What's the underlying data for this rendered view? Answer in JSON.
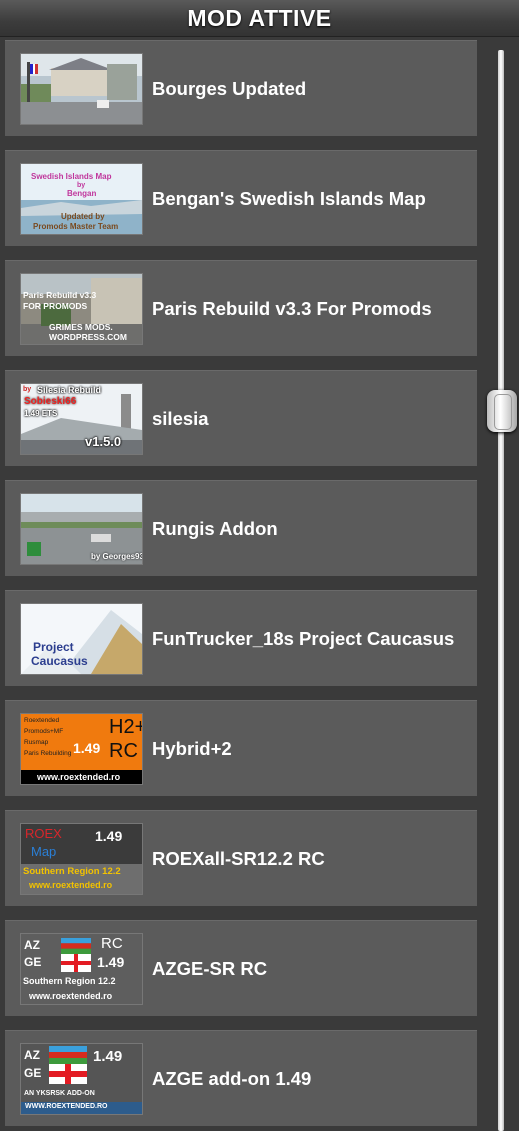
{
  "header": {
    "title": "MOD ATTIVE"
  },
  "mods": [
    {
      "name": "Bourges Updated",
      "thumb": {}
    },
    {
      "name": "Bengan's Swedish Islands Map",
      "thumb": {
        "line1": "Swedish Islands Map",
        "line2": "by",
        "line3": "Bengan",
        "line4": "Updated by",
        "line5": "Promods Master Team"
      }
    },
    {
      "name": "Paris Rebuild v3.3 For Promods",
      "thumb": {
        "line1": "Paris Rebuild v3.3",
        "line2": "FOR PROMODS",
        "line3": "GRIMES MODS.",
        "line4": "WORDPRESS.COM"
      }
    },
    {
      "name": "silesia",
      "thumb": {
        "line1": "by",
        "line2": "Silesia Rebuild",
        "line3": "Sobieski66",
        "line4": "1.49 ETS",
        "line5": "v1.5.0"
      }
    },
    {
      "name": "Rungis Addon",
      "thumb": {
        "line1": "by Georges93"
      }
    },
    {
      "name": "FunTrucker_18s Project Caucasus",
      "thumb": {
        "line1": "Project",
        "line2": "Caucasus"
      }
    },
    {
      "name": "Hybrid+2",
      "thumb": {
        "line1": "Roextended",
        "line2": "Promods+MF",
        "line3": "Rusmap",
        "line4": "Paris Rebuilding",
        "line5": "1.49",
        "line6": "H2+",
        "line7": "RC",
        "line8": "www.roextended.ro"
      }
    },
    {
      "name": "ROEXall-SR12.2 RC",
      "thumb": {
        "line1": "ROEX",
        "line2": "Map",
        "line3": "1.49",
        "line4": "Southern Region 12.2",
        "line5": "www.roextended.ro"
      }
    },
    {
      "name": "AZGE-SR RC",
      "thumb": {
        "line1": "AZ",
        "line2": "GE",
        "line3": "RC",
        "line4": "1.49",
        "line5": "Southern Region 12.2",
        "line6": "www.roextended.ro"
      }
    },
    {
      "name": "AZGE add-on 1.49",
      "thumb": {
        "line1": "AZ",
        "line2": "GE",
        "line3": "1.49",
        "line4": "AN YKSRSK ADD-ON",
        "line5": "WWW.ROEXTENDED.RO"
      }
    }
  ]
}
